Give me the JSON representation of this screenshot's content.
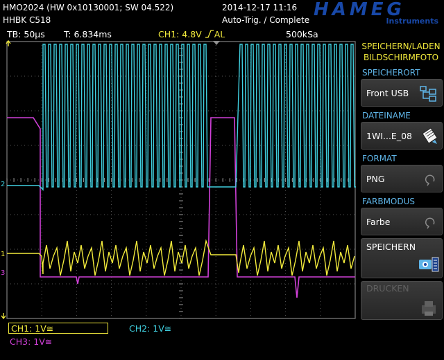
{
  "header": {
    "device": "HMO2024 (HW 0x10130001; SW 04.522)",
    "serial": "HHBK C518",
    "date": "2014-12-17 11:16",
    "trigger_status": "Auto-Trig. / Complete",
    "brand": "HAMEG",
    "brand_sub": "Instruments"
  },
  "status": {
    "timebase": "TB: 50µs",
    "time": "T: 6.834ms",
    "trigger": "CH1: 4.8V",
    "trigger_mode": "AL",
    "sample_rate": "500kSa"
  },
  "menu": {
    "title1": "SPEICHERN/LADEN",
    "title2": "BILDSCHIRMFOTO",
    "sections": [
      {
        "title": "SPEICHERORT",
        "value": "Front USB",
        "icon": "usb-storage-icon"
      },
      {
        "title": "DATEINAME",
        "value": "1WI...E_08",
        "icon": "file-edit-icon"
      },
      {
        "title": "FORMAT",
        "value": "PNG",
        "icon": "rotate-icon"
      },
      {
        "title": "FARBMODUS",
        "value": "Farbe",
        "icon": "rotate-icon"
      }
    ],
    "save": "SPEICHERN",
    "print": "DRUCKEN"
  },
  "channels": {
    "ch1": "CH1: 1V",
    "ch2": "CH2: 1V",
    "ch3": "CH3: 1V",
    "coupling_symbol": "≅"
  },
  "markers": {
    "ch2": "2",
    "ch1": "1",
    "ch3": "3"
  },
  "colors": {
    "ch1": "#f2ea3c",
    "ch2": "#40d0e0",
    "ch3": "#d040d8",
    "accent": "#5fb5e8"
  }
}
